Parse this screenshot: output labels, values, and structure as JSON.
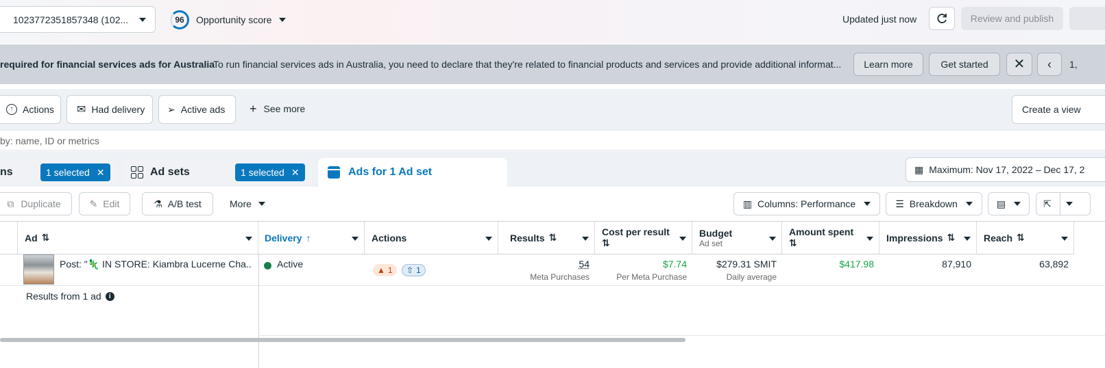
{
  "top": {
    "account_id": "1023772351857348 (102...",
    "score_value": "96",
    "score_label": "Opportunity score",
    "updated": "Updated just now",
    "review_publish": "Review and publish"
  },
  "banner": {
    "title": "required for financial services ads for Australia",
    "message": "To run financial services ads in Australia, you need to declare that they're related to financial products and services and provide additional informat...",
    "learn_more": "Learn more",
    "get_started": "Get started",
    "page": "1,"
  },
  "filters": {
    "actions": "Actions",
    "had_delivery": "Had delivery",
    "active_ads": "Active ads",
    "see_more": "See more",
    "create_view": "Create a view"
  },
  "search": {
    "placeholder": "by: name, ID or metrics"
  },
  "tabs": {
    "campaigns_tail": "ns",
    "campaigns_selected": "1 selected",
    "adsets": "Ad sets",
    "adsets_selected": "1 selected",
    "ads": "Ads for 1 Ad set",
    "date_range": "Maximum: Nov 17, 2022 – Dec 17, 2"
  },
  "toolbar": {
    "duplicate": "Duplicate",
    "edit": "Edit",
    "ab_test": "A/B test",
    "more": "More",
    "columns": "Columns: Performance",
    "breakdown": "Breakdown"
  },
  "table": {
    "headers": {
      "ad": "Ad",
      "delivery": "Delivery",
      "actions": "Actions",
      "results": "Results",
      "cost_per_result": "Cost per result",
      "budget": "Budget",
      "budget_sub": "Ad set",
      "amount_spent": "Amount spent",
      "impressions": "Impressions",
      "reach": "Reach"
    },
    "row": {
      "ad_name": "Post: \"🦎 IN STORE: Kiambra Lucerne Cha...",
      "delivery": "Active",
      "warn_count": "1",
      "info_count": "1",
      "results": "54",
      "results_sub": "Meta Purchases",
      "cost": "$7.74",
      "cost_sub": "Per Meta Purchase",
      "budget": "$279.31 SMIT",
      "budget_sub": "Daily average",
      "amount_spent": "$417.98",
      "impressions": "87,910",
      "reach": "63,892"
    },
    "footer": "Results from 1 ad"
  },
  "colors": {
    "accent": "#0a78be",
    "green": "#16a34a",
    "active": "#1b7f4b"
  }
}
